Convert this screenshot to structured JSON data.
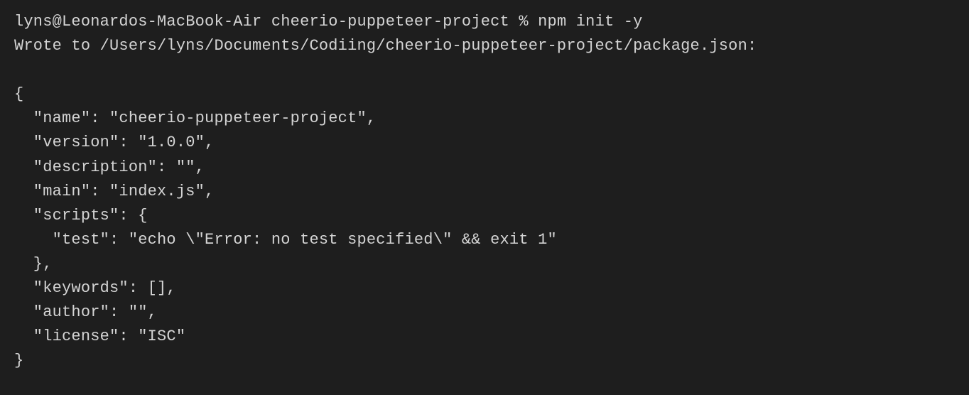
{
  "terminal": {
    "prompt_user": "lyns@Leonardos-MacBook-Air",
    "prompt_dir": "cheerio-puppeteer-project",
    "prompt_symbol": "%",
    "command": "npm init -y",
    "wrote_line": "Wrote to /Users/lyns/Documents/Codiing/cheerio-puppeteer-project/package.json:",
    "blank": "",
    "json_open": "{",
    "json_name": "  \"name\": \"cheerio-puppeteer-project\",",
    "json_version": "  \"version\": \"1.0.0\",",
    "json_description": "  \"description\": \"\",",
    "json_main": "  \"main\": \"index.js\",",
    "json_scripts_open": "  \"scripts\": {",
    "json_scripts_test": "    \"test\": \"echo \\\"Error: no test specified\\\" && exit 1\"",
    "json_scripts_close": "  },",
    "json_keywords": "  \"keywords\": [],",
    "json_author": "  \"author\": \"\",",
    "json_license": "  \"license\": \"ISC\"",
    "json_close": "}"
  }
}
